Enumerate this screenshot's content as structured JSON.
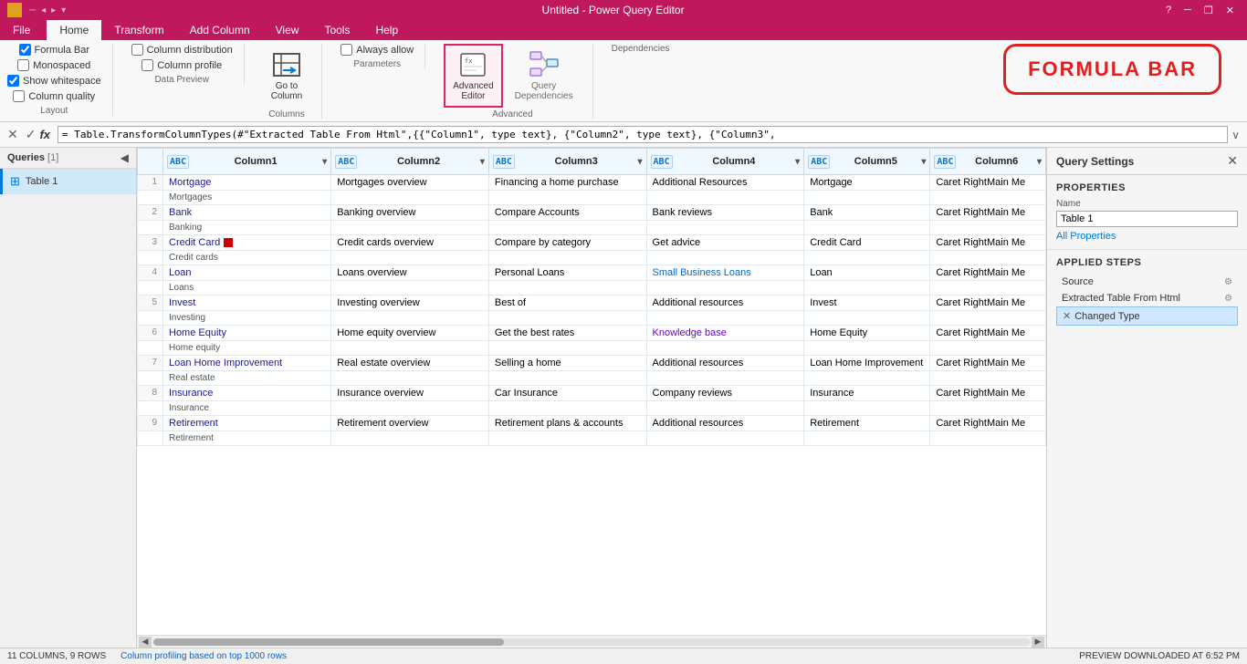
{
  "titlebar": {
    "title": "Untitled - Power Query Editor",
    "win_icon": "■",
    "minimize": "─",
    "restore": "❐",
    "close": "✕"
  },
  "ribbon": {
    "tabs": [
      "File",
      "Home",
      "Transform",
      "Add Column",
      "View",
      "Tools",
      "Help"
    ],
    "active_tab": "Home",
    "file_label": "File",
    "groups": {
      "layout": {
        "label": "Layout",
        "formula_bar_label": "Formula Bar",
        "monospaced_label": "Monospaced",
        "show_whitespace_label": "Show whitespace",
        "column_quality_label": "Column quality",
        "data_preview_label": "Data Preview",
        "column_distribution_label": "Column distribution",
        "column_profile_label": "Column profile"
      },
      "columns": {
        "label": "Columns",
        "go_to_column_label": "Go to\nColumn"
      },
      "parameters": {
        "label": "Parameters",
        "always_allow_label": "Always allow"
      },
      "advanced": {
        "label": "Advanced",
        "advanced_editor_label": "Advanced\nEditor",
        "query_dependencies_label": "Query\nDependencies"
      },
      "dependencies": {
        "label": "Dependencies"
      }
    }
  },
  "formula_bar": {
    "cancel_btn": "✕",
    "confirm_btn": "✓",
    "fx_label": "fx",
    "formula": "= Table.TransformColumnTypes(#\"Extracted Table From Html\",{{\"Column1\", type text}, {\"Column2\", type text}, {\"Column3\",",
    "expand_btn": "∨"
  },
  "callout": {
    "text": "FORMULA BAR"
  },
  "queries_panel": {
    "title": "Queries",
    "count": "[1]",
    "items": [
      {
        "name": "Table 1",
        "type": "table"
      }
    ]
  },
  "table": {
    "columns": [
      {
        "name": "Column1",
        "type": "ABC",
        "has_filter": true
      },
      {
        "name": "Column2",
        "type": "ABC",
        "has_filter": true
      },
      {
        "name": "Column3",
        "type": "ABC",
        "has_filter": true
      },
      {
        "name": "Column4",
        "type": "ABC",
        "has_filter": true
      },
      {
        "name": "Column5",
        "type": "ABC",
        "has_filter": true
      },
      {
        "name": "Column6",
        "type": "ABC",
        "has_filter": true
      }
    ],
    "rows": [
      {
        "num": 1,
        "col1_primary": "Mortgage",
        "col1_secondary": "Mortgages",
        "col2": "Mortgages overview",
        "col3": "Financing a home purchase",
        "col4": "Additional Resources",
        "col5": "Mortgage",
        "col6": "Caret RightMain Me"
      },
      {
        "num": 2,
        "col1_primary": "Bank",
        "col1_secondary": "Banking",
        "col2": "Banking overview",
        "col3": "Compare Accounts",
        "col4": "Bank reviews",
        "col5": "Bank",
        "col6": "Caret RightMain Me"
      },
      {
        "num": 3,
        "col1_primary": "Credit Card",
        "col1_secondary": "Credit cards",
        "col2": "Credit cards overview",
        "col3": "Compare by category",
        "col4": "Get advice",
        "col5": "Credit Card",
        "col6": "Caret RightMain Me"
      },
      {
        "num": 4,
        "col1_primary": "Loan",
        "col1_secondary": "Loans",
        "col2": "Loans overview",
        "col3": "Personal Loans",
        "col4": "Small Business Loans",
        "col5": "Loan",
        "col6": "Caret RightMain Me"
      },
      {
        "num": 5,
        "col1_primary": "Invest",
        "col1_secondary": "Investing",
        "col2": "Investing overview",
        "col3": "Best of",
        "col4": "Additional resources",
        "col5": "Invest",
        "col6": "Caret RightMain Me"
      },
      {
        "num": 6,
        "col1_primary": "Home Equity",
        "col1_secondary": "Home equity",
        "col2": "Home equity overview",
        "col3": "Get the best rates",
        "col4": "Knowledge base",
        "col5": "Home Equity",
        "col6": "Caret RightMain Me"
      },
      {
        "num": 7,
        "col1_primary": "Loan Home Improvement",
        "col1_secondary": "Real estate",
        "col2": "Real estate overview",
        "col3": "Selling a home",
        "col4": "Additional resources",
        "col5": "Loan Home Improvement",
        "col6": "Caret RightMain Me"
      },
      {
        "num": 8,
        "col1_primary": "Insurance",
        "col1_secondary": "Insurance",
        "col2": "Insurance overview",
        "col3": "Car Insurance",
        "col4": "Company reviews",
        "col5": "Insurance",
        "col6": "Caret RightMain Me"
      },
      {
        "num": 9,
        "col1_primary": "Retirement",
        "col1_secondary": "Retirement",
        "col2": "Retirement overview",
        "col3": "Retirement plans & accounts",
        "col4": "Additional resources",
        "col5": "Retirement",
        "col6": "Caret RightMain Me"
      }
    ]
  },
  "query_settings": {
    "title": "Query Settings",
    "close_btn": "✕",
    "properties_title": "PROPERTIES",
    "name_label": "Name",
    "name_value": "Table 1",
    "all_properties_link": "All Properties",
    "applied_steps_title": "APPLIED STEPS",
    "steps": [
      {
        "name": "Source",
        "has_gear": true,
        "has_delete": false,
        "active": false
      },
      {
        "name": "Extracted Table From Html",
        "has_gear": true,
        "has_delete": false,
        "active": false
      },
      {
        "name": "Changed Type",
        "has_gear": false,
        "has_delete": true,
        "active": true
      }
    ]
  },
  "status_bar": {
    "columns": "11 COLUMNS, 9 ROWS",
    "profiling": "Column profiling based on top 1000 rows",
    "preview": "PREVIEW DOWNLOADED AT 6:52 PM"
  }
}
